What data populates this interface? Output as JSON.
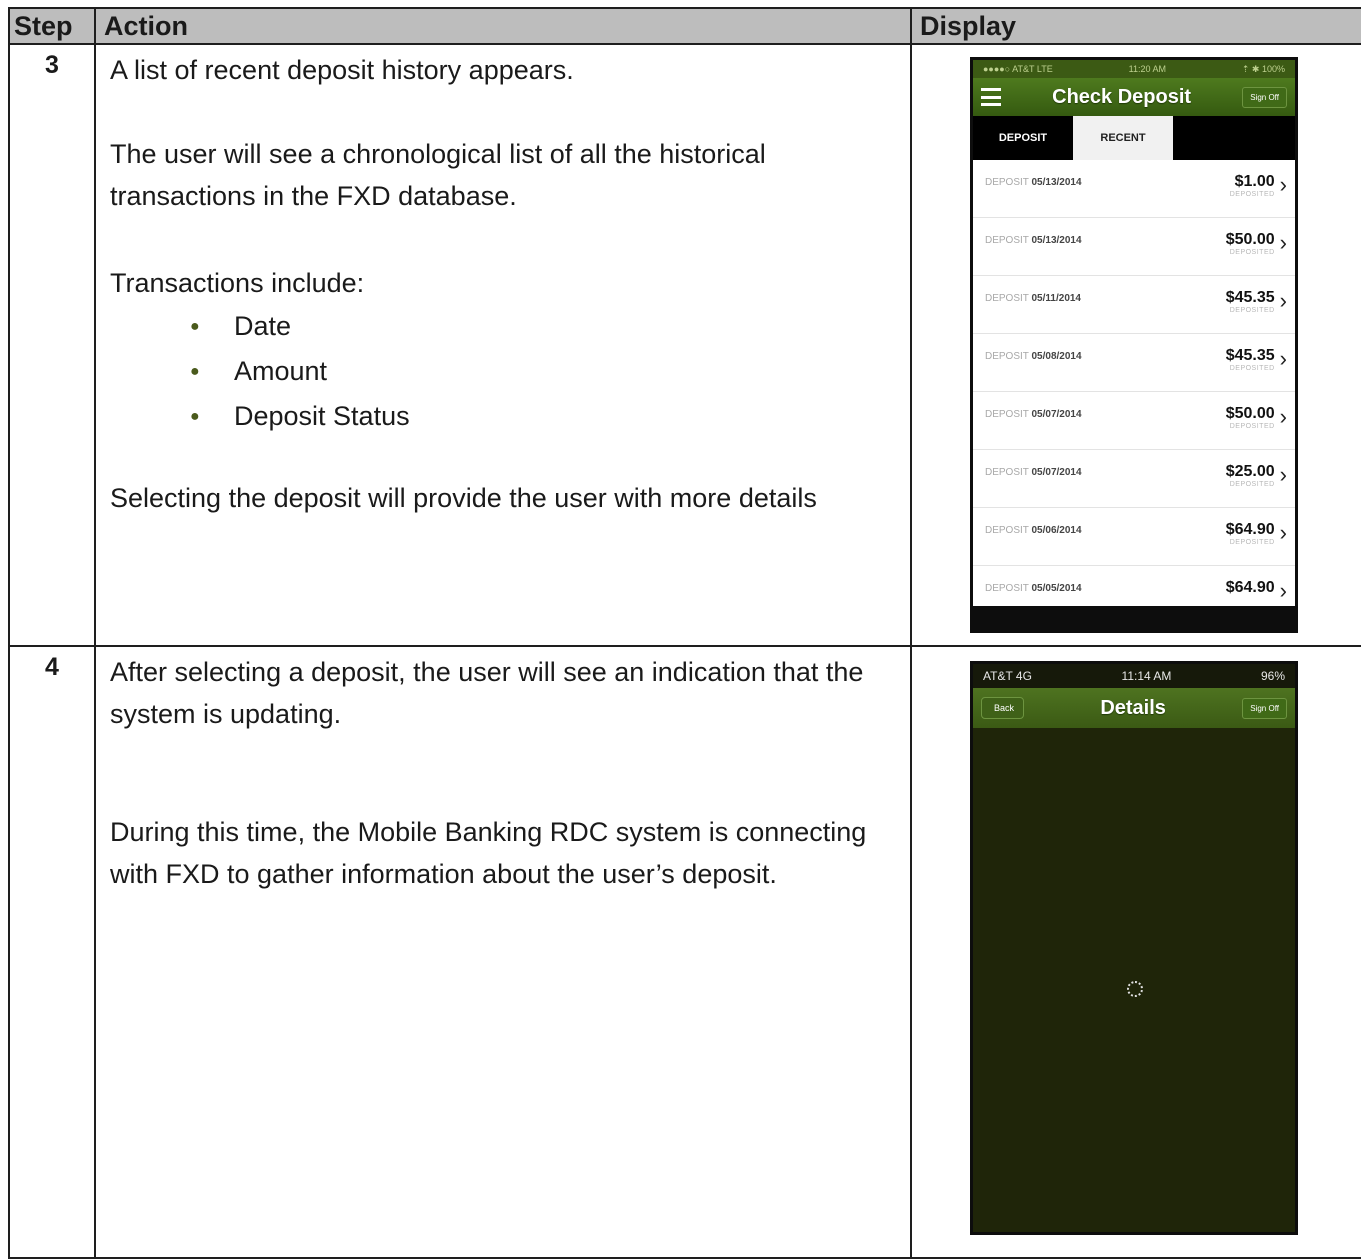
{
  "table": {
    "headers": {
      "step": "Step",
      "action": "Action",
      "display": "Display"
    }
  },
  "row1": {
    "step": "3",
    "p1": "A list of recent deposit history appears.",
    "p2": "The user will see a chronological list of all the historical transactions in the FXD database.",
    "p3": "Transactions include:",
    "bullets": [
      "Date",
      "Amount",
      "Deposit Status"
    ],
    "p4": "Selecting the deposit will provide the user with more details",
    "phone": {
      "status_left": "●●●●○ AT&T  LTE",
      "status_time": "11:20 AM",
      "status_right": "⇡ ✱ 100%",
      "title": "Check Deposit",
      "sign_off": "Sign Off",
      "tabs": [
        "DEPOSIT",
        "RECENT"
      ],
      "items": [
        {
          "label": "DEPOSIT",
          "date": "05/13/2014",
          "amount": "$1.00",
          "status": "DEPOSITED"
        },
        {
          "label": "DEPOSIT",
          "date": "05/13/2014",
          "amount": "$50.00",
          "status": "DEPOSITED"
        },
        {
          "label": "DEPOSIT",
          "date": "05/11/2014",
          "amount": "$45.35",
          "status": "DEPOSITED"
        },
        {
          "label": "DEPOSIT",
          "date": "05/08/2014",
          "amount": "$45.35",
          "status": "DEPOSITED"
        },
        {
          "label": "DEPOSIT",
          "date": "05/07/2014",
          "amount": "$50.00",
          "status": "DEPOSITED"
        },
        {
          "label": "DEPOSIT",
          "date": "05/07/2014",
          "amount": "$25.00",
          "status": "DEPOSITED"
        },
        {
          "label": "DEPOSIT",
          "date": "05/06/2014",
          "amount": "$64.90",
          "status": "DEPOSITED"
        },
        {
          "label": "DEPOSIT",
          "date": "05/05/2014",
          "amount": "$64.90",
          "status": ""
        }
      ]
    }
  },
  "row2": {
    "step": "4",
    "p1": "After selecting a deposit, the user will see an indication that the system is updating.",
    "p2": "During this time, the Mobile Banking RDC system is connecting with FXD to gather information about the user’s deposit.",
    "phone": {
      "status_left": "AT&T  4G",
      "status_time": "11:14 AM",
      "status_right": "96%",
      "back": "Back",
      "title": "Details",
      "sign_off": "Sign Off"
    }
  }
}
